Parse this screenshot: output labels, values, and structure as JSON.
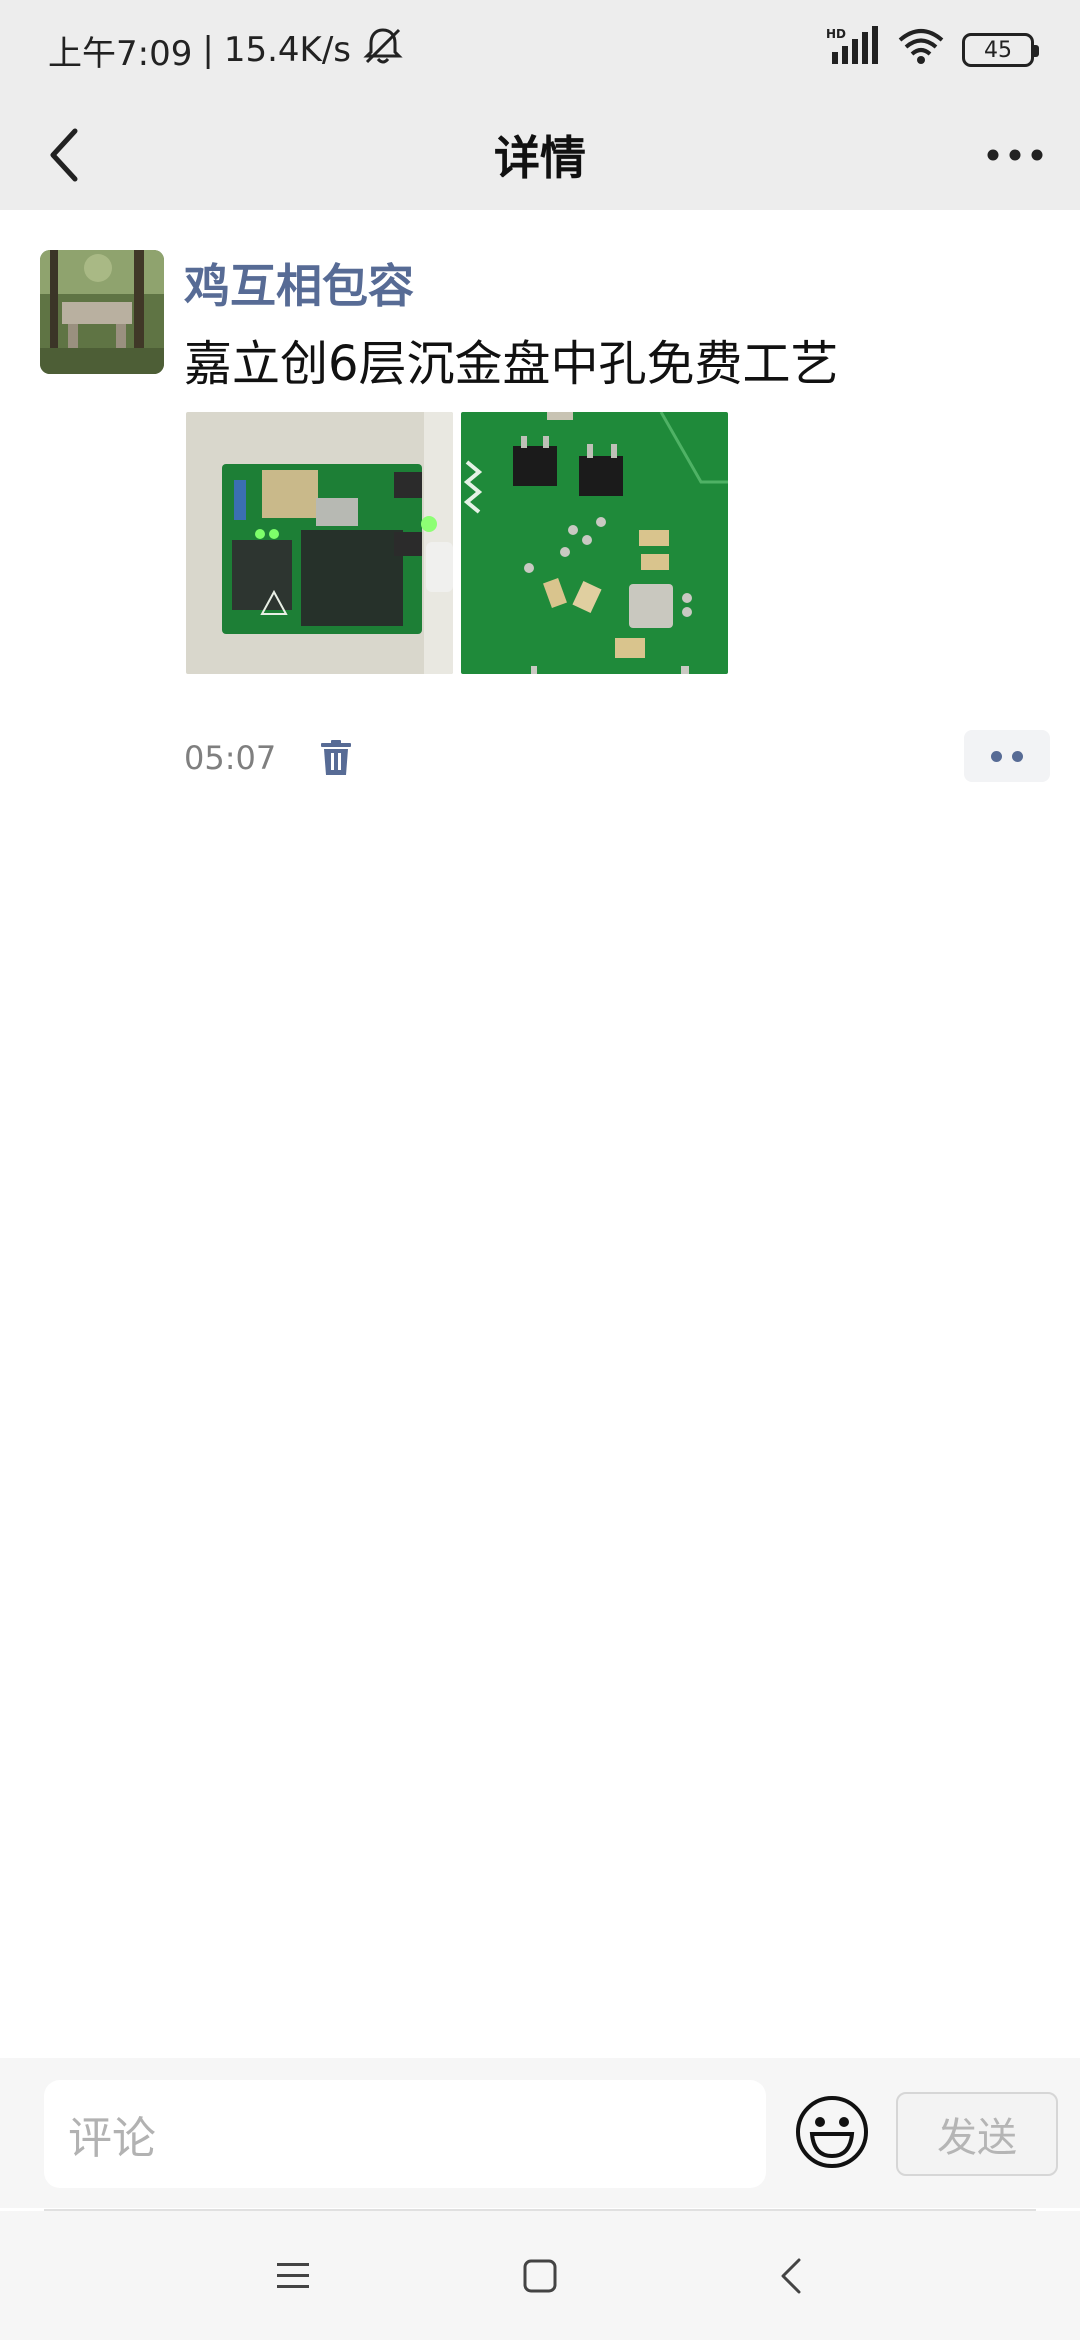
{
  "status_bar": {
    "time": "上午7:09",
    "separator": "|",
    "net_speed": "15.4K/s",
    "battery": "45",
    "hd_label": "HD"
  },
  "navbar": {
    "title": "详情"
  },
  "post": {
    "author": "鸡互相包容",
    "text": "嘉立创6层沉金盘中孔免费工艺",
    "time": "05:07",
    "photos": [
      "pcb-board-photo",
      "pcb-closeup-photo"
    ]
  },
  "comment_bar": {
    "placeholder": "评论",
    "send_label": "发送"
  },
  "colors": {
    "author": "#576b95",
    "bar_bg": "#ededed",
    "pcb_green": "#1f8a3a"
  }
}
